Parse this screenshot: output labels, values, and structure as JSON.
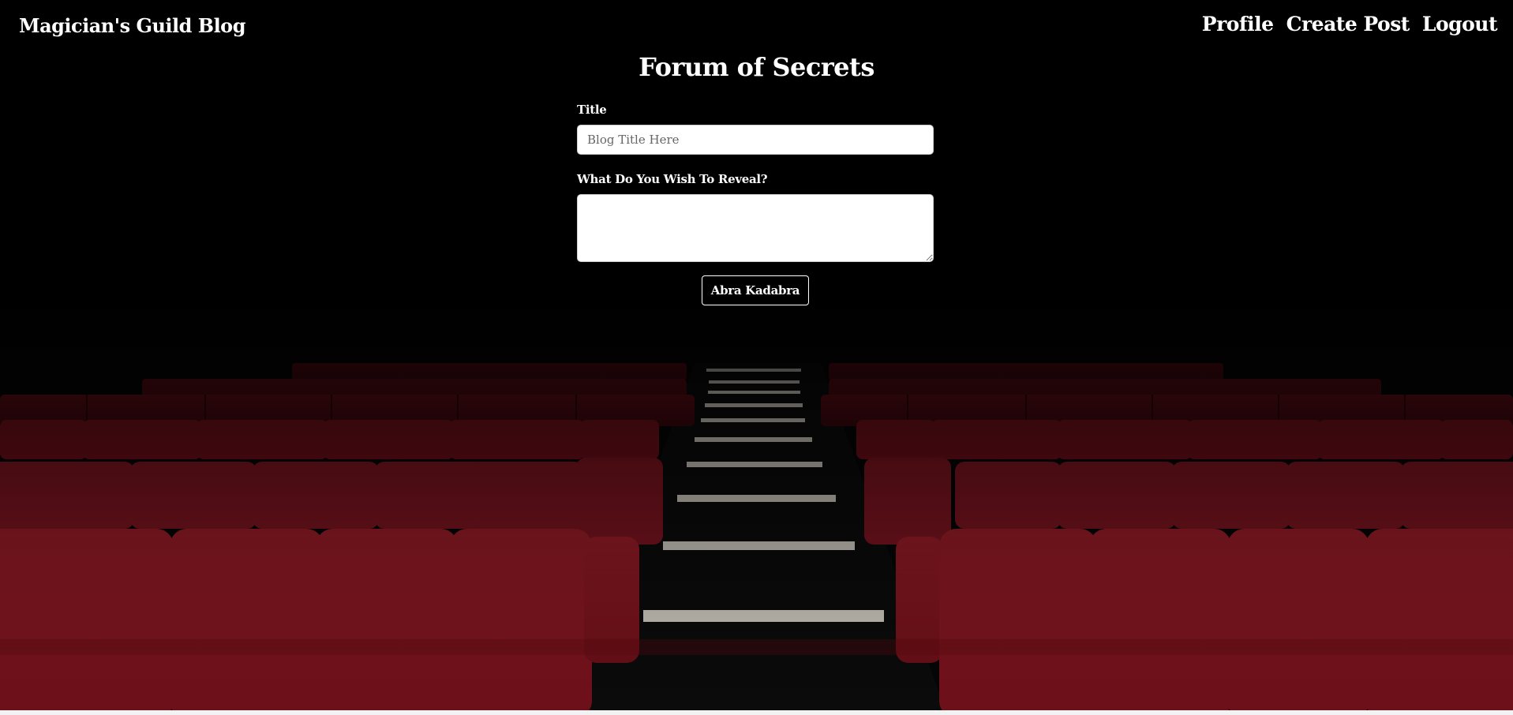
{
  "navbar": {
    "brand": "Magician's Guild Blog",
    "links": [
      {
        "label": "Profile"
      },
      {
        "label": "Create Post"
      },
      {
        "label": "Logout"
      }
    ]
  },
  "main": {
    "heading": "Forum of Secrets",
    "form": {
      "title_label": "Title",
      "title_placeholder": "Blog Title Here",
      "title_value": "",
      "body_label": "What Do You Wish To Reveal?",
      "body_value": "",
      "submit_label": "Abra Kadabra"
    }
  },
  "background": {
    "description_icon": "theater-seats-image",
    "seat_color": "#8b1a24",
    "backdrop_color": "#000000"
  }
}
